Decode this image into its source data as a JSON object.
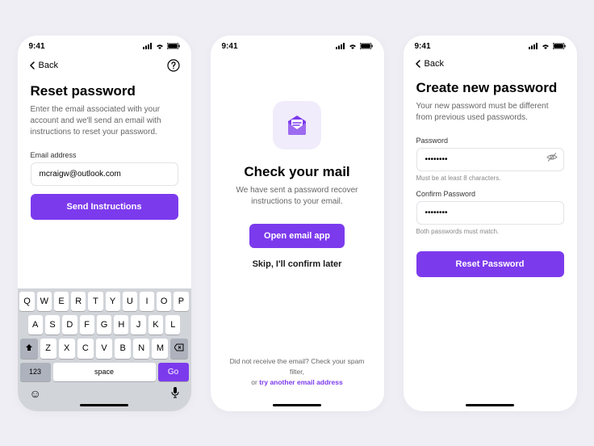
{
  "status": {
    "time": "9:41"
  },
  "nav": {
    "back": "Back"
  },
  "colors": {
    "accent": "#7c3aed"
  },
  "screen1": {
    "title": "Reset password",
    "subtitle": "Enter the email associated with your account and we'll send an email with instructions to reset your password.",
    "email_label": "Email address",
    "email_value": "mcraigw@outlook.com",
    "button": "Send Instructions"
  },
  "screen2": {
    "title": "Check your mail",
    "subtitle": "We have sent a password recover instructions to your email.",
    "primary_button": "Open email app",
    "secondary_link": "Skip, I'll confirm later",
    "footer_pre": "Did not receive the email? Check your spam filter,",
    "footer_or": "or ",
    "footer_action": "try another email address"
  },
  "screen3": {
    "title": "Create new password",
    "subtitle": "Your new password must be different from previous used passwords.",
    "password_label": "Password",
    "password_value": "••••••••",
    "password_hint": "Must be at least 8 characters.",
    "confirm_label": "Confirm Password",
    "confirm_value": "••••••••",
    "confirm_hint": "Both passwords must match.",
    "button": "Reset Password"
  },
  "keyboard": {
    "row1": [
      "Q",
      "W",
      "E",
      "R",
      "T",
      "Y",
      "U",
      "I",
      "O",
      "P"
    ],
    "row2": [
      "A",
      "S",
      "D",
      "F",
      "G",
      "H",
      "J",
      "K",
      "L"
    ],
    "row3": [
      "Z",
      "X",
      "C",
      "V",
      "B",
      "N",
      "M"
    ],
    "num_key": "123",
    "space_key": "space",
    "go_key": "Go"
  }
}
